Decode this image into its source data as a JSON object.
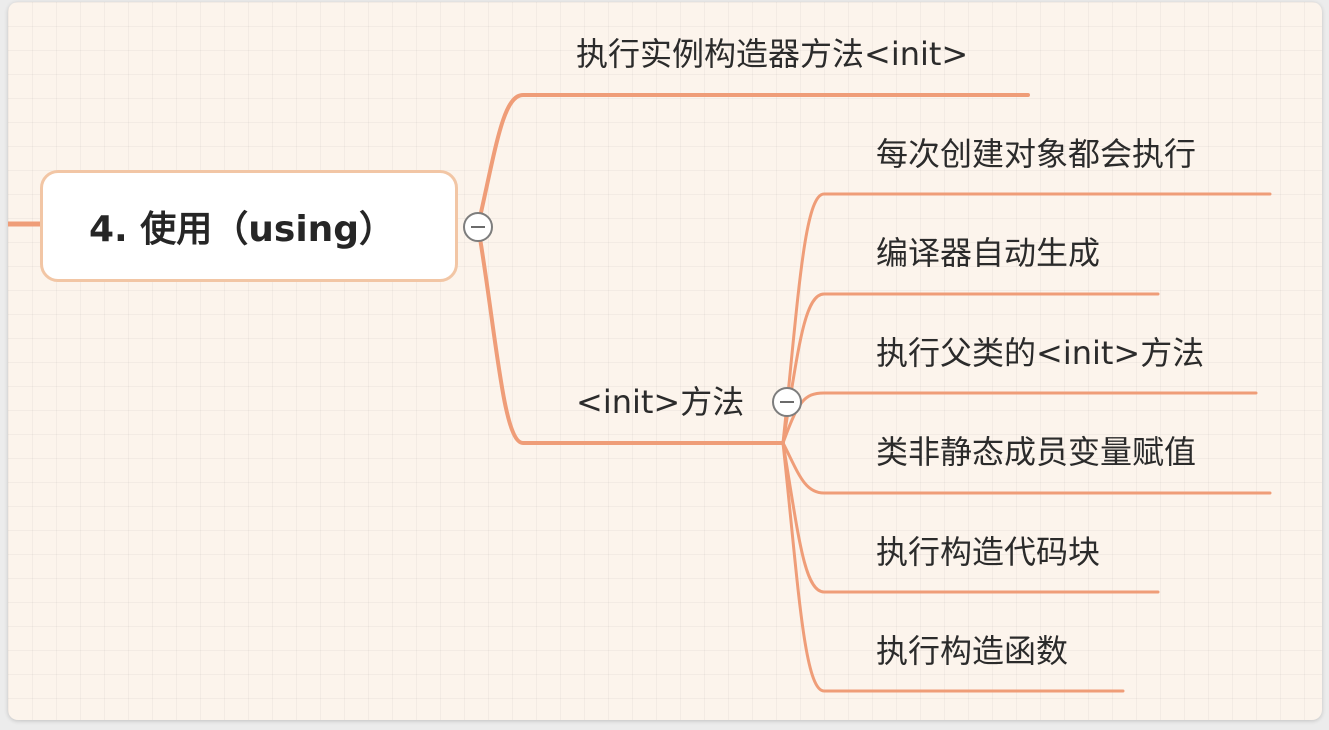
{
  "mindmap": {
    "root": {
      "label": "4. 使用（using）"
    },
    "branch_1": {
      "label": "执行实例构造器方法<init>"
    },
    "branch_2": {
      "label": "<init>方法",
      "children": [
        "每次创建对象都会执行",
        "编译器自动生成",
        "执行父类的<init>方法",
        "类非静态成员变量赋值",
        "执行构造代码块",
        "执行构造函数"
      ]
    }
  },
  "colors": {
    "connector": "#ef9d78",
    "root_border": "#f2c6a5",
    "canvas_background": "#fcf4ec"
  },
  "icons": {
    "collapse": "minus-circle-icon"
  }
}
